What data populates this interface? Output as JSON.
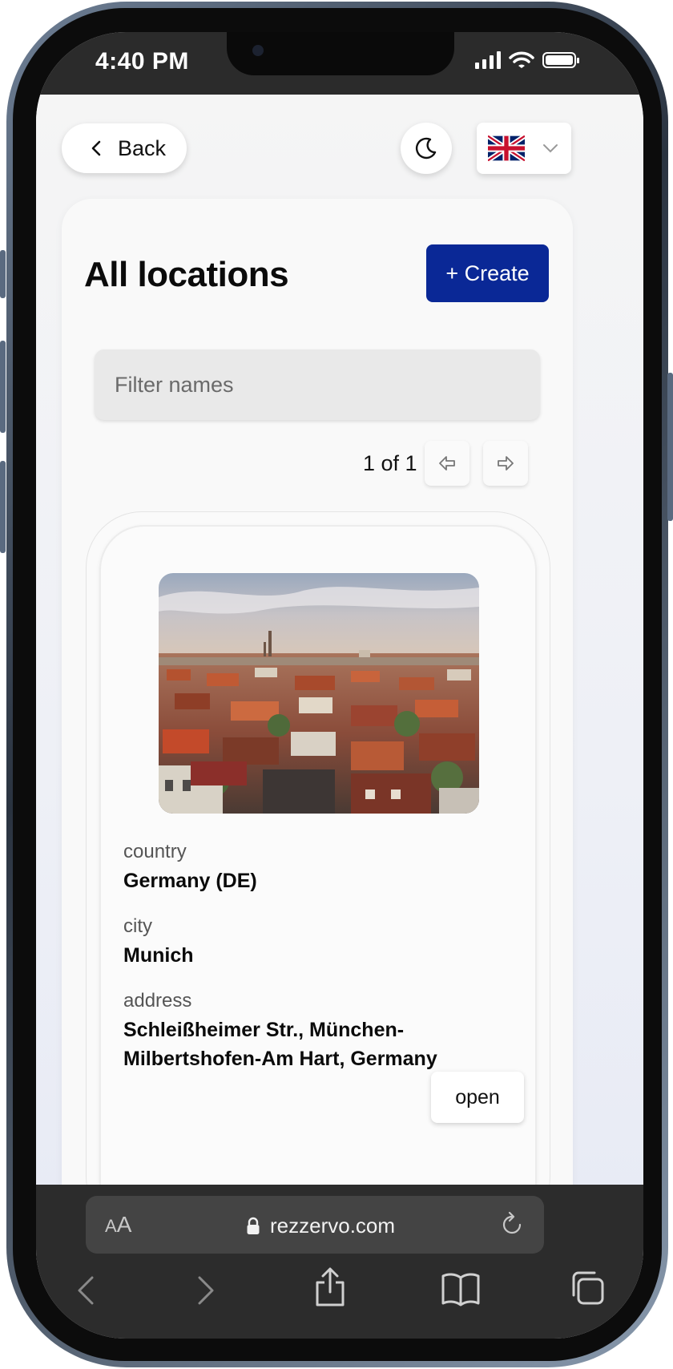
{
  "status": {
    "time": "4:40 PM"
  },
  "topbar": {
    "back_label": "Back"
  },
  "main": {
    "title": "All locations",
    "create_label": "+ Create",
    "filter_placeholder": "Filter names",
    "pager_text": "1 of 1"
  },
  "location": {
    "country_label": "country",
    "country_value": "Germany (DE)",
    "city_label": "city",
    "city_value": "Munich",
    "address_label": "address",
    "address_value": "Schleißheimer Str., München-Milbertshofen-Am Hart, Germany",
    "open_label": "open"
  },
  "browser": {
    "aa_small": "A",
    "aa_large": "A",
    "url": "rezzervo.com"
  },
  "colors": {
    "accent": "#0a2896",
    "page_bg": "#f5f5f5",
    "browser_bg": "#2c2c2c"
  },
  "icons": [
    "chevron-left-icon",
    "moon-icon",
    "uk-flag-icon",
    "chevron-down-icon",
    "arrow-left-icon",
    "arrow-right-icon",
    "lock-icon",
    "reload-icon",
    "share-icon",
    "book-icon",
    "tabs-icon"
  ]
}
